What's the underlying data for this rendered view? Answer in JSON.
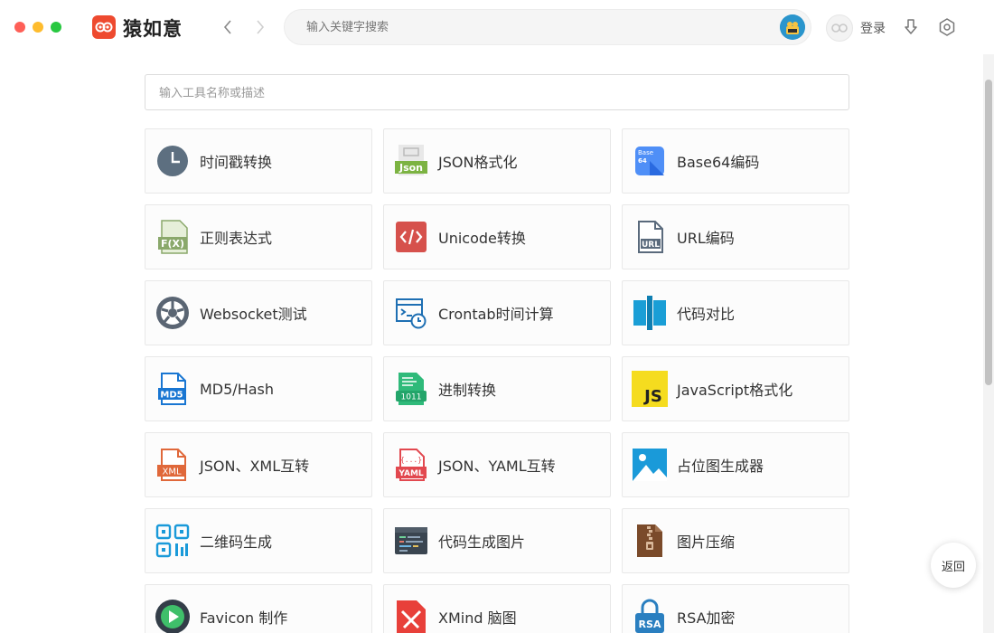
{
  "app": {
    "title": "猿如意",
    "login_label": "登录"
  },
  "search": {
    "placeholder": "输入关键字搜索",
    "value": ""
  },
  "filter": {
    "placeholder": "输入工具名称或描述",
    "value": ""
  },
  "tools": [
    {
      "label": "时间戳转换",
      "icon": "clock-icon"
    },
    {
      "label": "JSON格式化",
      "icon": "json-icon"
    },
    {
      "label": "Base64编码",
      "icon": "base64-icon"
    },
    {
      "label": "正则表达式",
      "icon": "regex-icon"
    },
    {
      "label": "Unicode转换",
      "icon": "code-icon"
    },
    {
      "label": "URL编码",
      "icon": "url-icon"
    },
    {
      "label": "Websocket测试",
      "icon": "websocket-icon"
    },
    {
      "label": "Crontab时间计算",
      "icon": "crontab-icon"
    },
    {
      "label": "代码对比",
      "icon": "diff-icon"
    },
    {
      "label": "MD5/Hash",
      "icon": "md5-icon"
    },
    {
      "label": "进制转换",
      "icon": "binary-icon"
    },
    {
      "label": "JavaScript格式化",
      "icon": "javascript-icon"
    },
    {
      "label": "JSON、XML互转",
      "icon": "xml-icon"
    },
    {
      "label": "JSON、YAML互转",
      "icon": "yaml-icon"
    },
    {
      "label": "占位图生成器",
      "icon": "image-placeholder-icon"
    },
    {
      "label": "二维码生成",
      "icon": "qrcode-icon"
    },
    {
      "label": "代码生成图片",
      "icon": "code-image-icon"
    },
    {
      "label": "图片压缩",
      "icon": "zip-icon"
    },
    {
      "label": "Favicon 制作",
      "icon": "favicon-icon"
    },
    {
      "label": "XMind 脑图",
      "icon": "xmind-icon"
    },
    {
      "label": "RSA加密",
      "icon": "rsa-icon"
    }
  ],
  "back_button": {
    "label": "返回"
  },
  "colors": {
    "accent": "#ee4a2f",
    "card_border": "#e8e8e8",
    "card_bg": "#fcfcfc"
  }
}
